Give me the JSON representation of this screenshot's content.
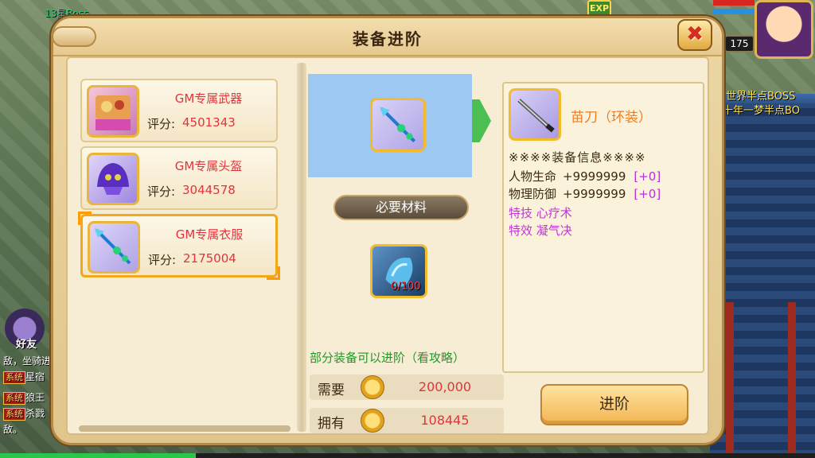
{
  "hud": {
    "boss_label": "13星Boss",
    "exp_label": "EXP",
    "level": "175",
    "world_boss_title": "世界半点BOSS",
    "dream_boss_title": "十年一梦半点BO",
    "friend_label": "好友"
  },
  "chat": {
    "lines": [
      {
        "tag": "",
        "text": "敌，坐骑进"
      },
      {
        "tag": "系统",
        "text": "星宿"
      },
      {
        "tag": "系统",
        "text": "狼王"
      },
      {
        "tag": "系统",
        "text": "杀戮"
      },
      {
        "tag": "",
        "text": "敌。"
      }
    ]
  },
  "dialog": {
    "title": "装备进阶",
    "close_label": "✖"
  },
  "equipment_list": [
    {
      "name": "GM专属武器",
      "score_label": "评分:",
      "score": "4501343",
      "icon": "weapon-crate-icon",
      "selected": false
    },
    {
      "name": "GM专属头盔",
      "score_label": "评分:",
      "score": "3044578",
      "icon": "helmet-icon",
      "selected": false
    },
    {
      "name": "GM专属衣服",
      "score_label": "评分:",
      "score": "2175004",
      "icon": "spear-icon",
      "selected": true
    }
  ],
  "center": {
    "materials_title": "必要材料",
    "material_count": "0/100",
    "hint": "部分装备可以进阶（看攻略）",
    "cost": {
      "need_label": "需要",
      "need_value": "200,000",
      "have_label": "拥有",
      "have_value": "108445"
    }
  },
  "info": {
    "item_name": "苗刀（环装）",
    "header": "※※※※装备信息※※※※",
    "stats": [
      {
        "name": "人物生命",
        "value": "+9999999",
        "add": "[+0]"
      },
      {
        "name": "物理防御",
        "value": "+9999999",
        "add": "[+0]"
      }
    ],
    "special_skill": "特技  心疗术",
    "special_effect": "特效  凝气决"
  },
  "advance_button": "进阶",
  "colors": {
    "accent_red": "#e4333b",
    "hint_green": "#1f9a28",
    "special_purple": "#c233d6",
    "name_orange": "#f07d20"
  }
}
